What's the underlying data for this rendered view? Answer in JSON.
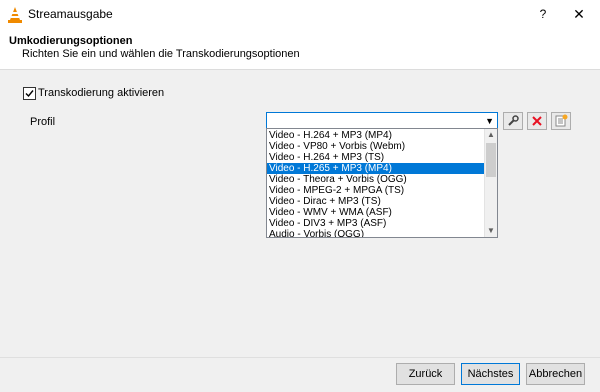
{
  "window": {
    "title": "Streamausgabe",
    "help_label": "?",
    "close_label": "✕",
    "icon": "vlc-cone-icon"
  },
  "header": {
    "title": "Umkodierungsoptionen",
    "subtitle": "Richten Sie ein und wählen die Transkodierungsoptionen"
  },
  "transcode": {
    "checkbox_label": "Transkodierung aktivieren",
    "checked": true
  },
  "profile": {
    "label": "Profil",
    "current_value": "",
    "tools": [
      "wrench-icon",
      "delete-icon",
      "new-profile-icon"
    ],
    "options": [
      "Video - H.264 + MP3 (MP4)",
      "Video - VP80 + Vorbis (Webm)",
      "Video - H.264 + MP3 (TS)",
      "Video - H.265 + MP3 (MP4)",
      "Video - Theora + Vorbis (OGG)",
      "Video - MPEG-2 + MPGA (TS)",
      "Video - Dirac + MP3 (TS)",
      "Video - WMV + WMA (ASF)",
      "Video - DIV3 + MP3 (ASF)",
      "Audio - Vorbis (OGG)"
    ],
    "selected_index": 3
  },
  "footer": {
    "back_label": "Zurück",
    "next_label": "Nächstes",
    "cancel_label": "Abbrechen"
  },
  "colors": {
    "accent": "#0078d7",
    "delete_red": "#e81123"
  }
}
